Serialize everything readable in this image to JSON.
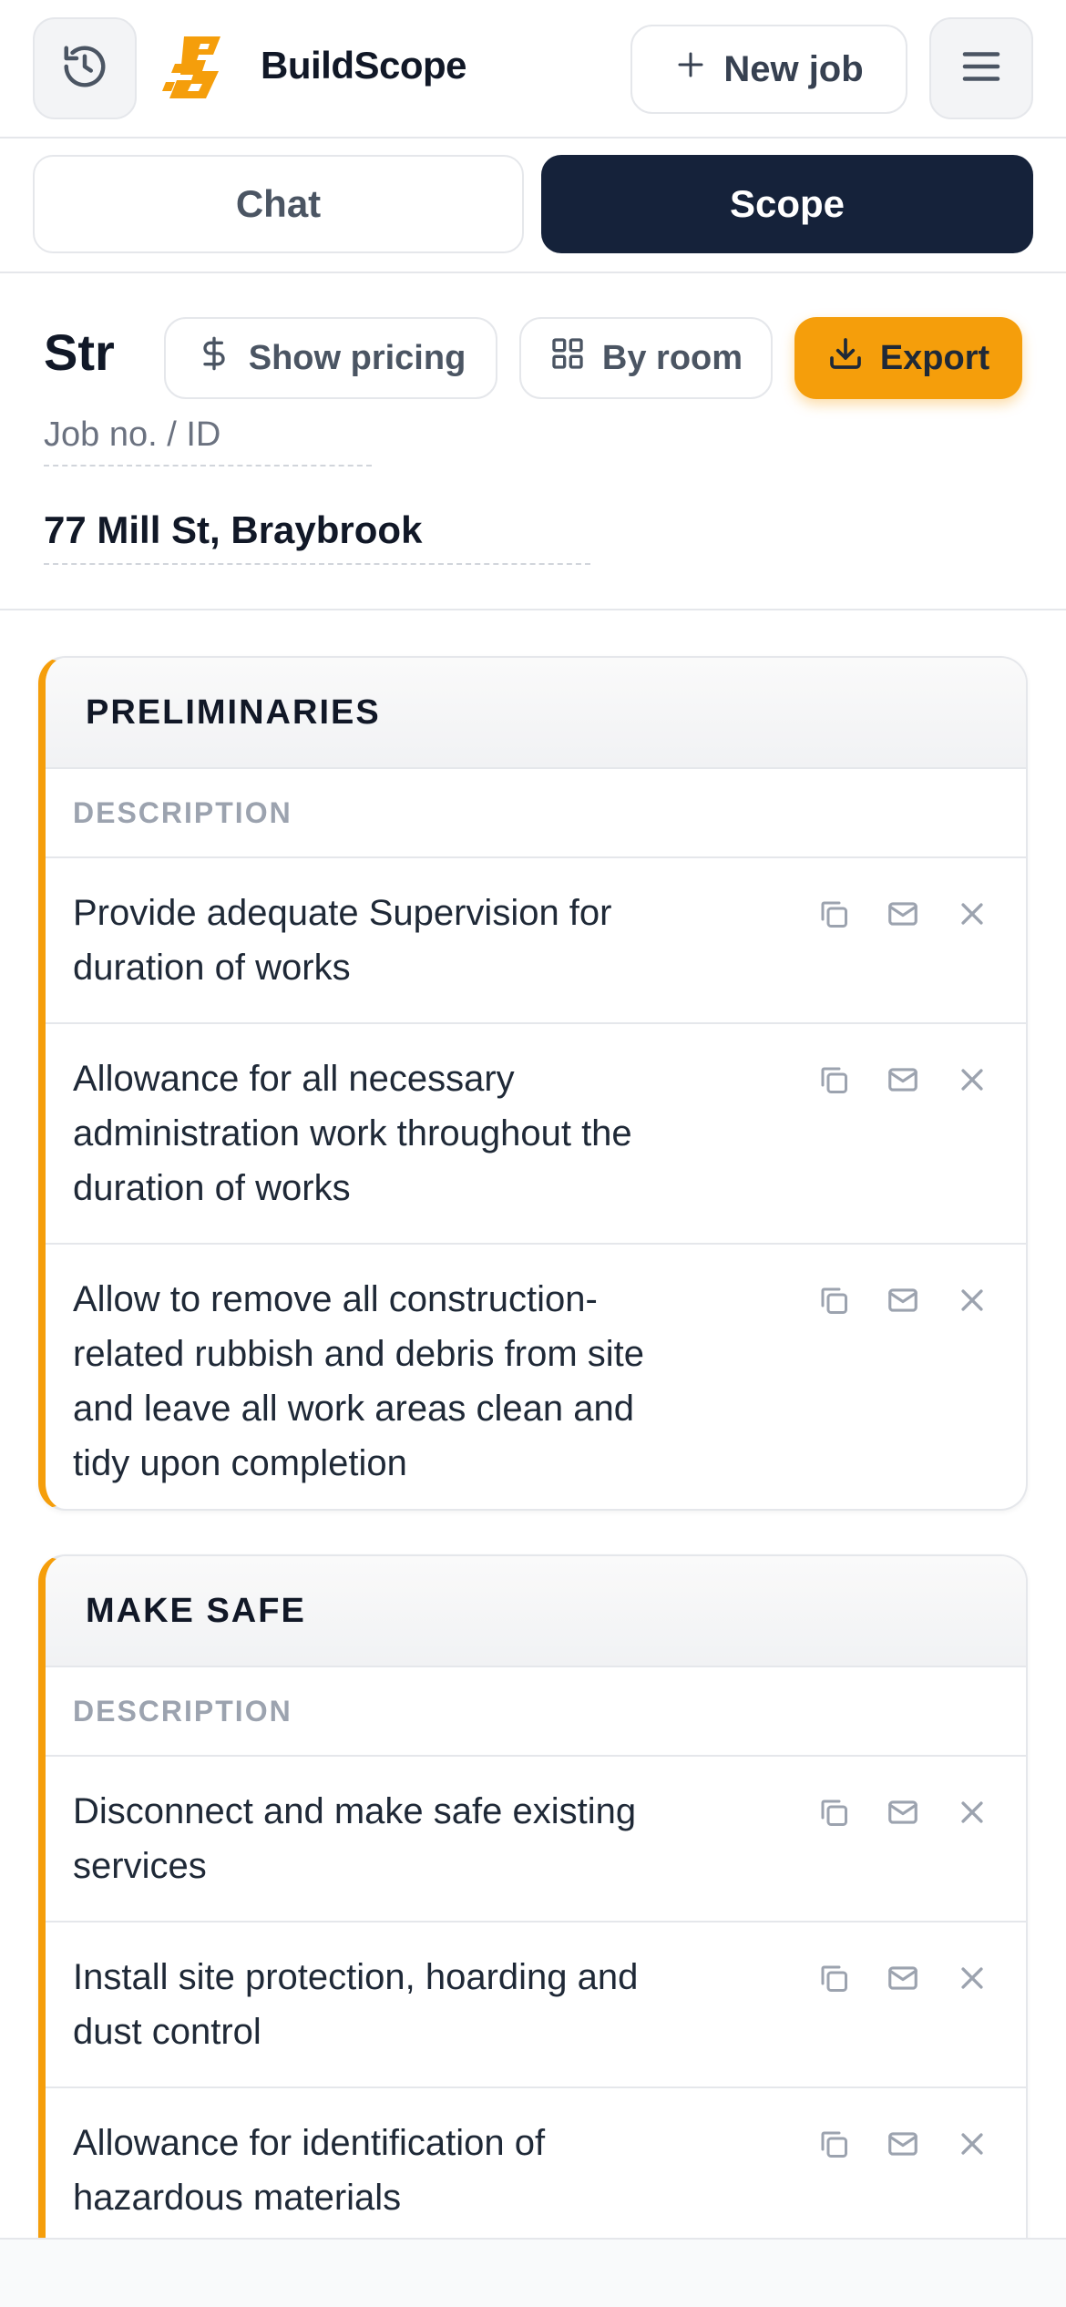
{
  "header": {
    "app_name": "BuildScope",
    "new_job_label": "New job",
    "icons": {
      "history": "history-icon",
      "logo": "buildscope-logo",
      "plus": "plus-icon",
      "menu": "hamburger-menu-icon"
    }
  },
  "tabs": [
    {
      "label": "Chat",
      "active": false
    },
    {
      "label": "Scope",
      "active": true
    }
  ],
  "scope": {
    "title_visible": "Str",
    "show_pricing_label": "Show pricing",
    "by_room_label": "By room",
    "export_label": "Export",
    "job_no_placeholder": "Job no. / ID",
    "address": "77 Mill St, Braybrook"
  },
  "colors": {
    "accent": "#f59e0b",
    "dark": "#15223a",
    "border": "#e5e7eb",
    "muted": "#9ca3af"
  },
  "sections": [
    {
      "title": "PRELIMINARIES",
      "column_header": "DESCRIPTION",
      "items": [
        "Provide adequate Supervision for duration of works",
        "Allowance for all necessary administration work throughout the duration of works",
        "Allow to remove all construction-related rubbish and debris from site and leave all work areas clean and tidy upon completion"
      ]
    },
    {
      "title": "MAKE SAFE",
      "column_header": "DESCRIPTION",
      "items": [
        "Disconnect and make safe existing services",
        "Install site protection, hoarding and dust control",
        "Allowance for identification of hazardous materials"
      ]
    }
  ]
}
